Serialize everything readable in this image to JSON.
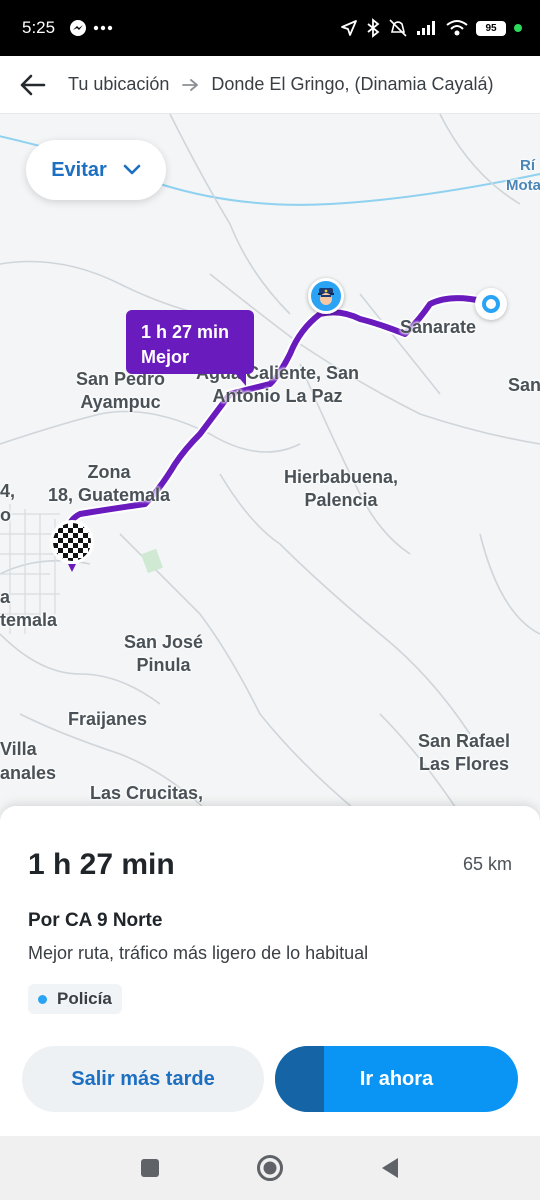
{
  "status_bar": {
    "time": "5:25",
    "battery": "95"
  },
  "header": {
    "from": "Tu ubicación",
    "to": "Donde El Gringo, (Dinamia Cayalá)"
  },
  "map": {
    "avoid_button": "Evitar",
    "route_bubble": {
      "duration": "1 h 27 min",
      "tag": "Mejor"
    },
    "labels": {
      "sanarate": "Sanarate",
      "san_pedro": "San Pedro\nAyampuc",
      "agua_caliente": "Agua Caliente, San\nAntonio La Paz",
      "zona18": "Zona\n18, Guatemala",
      "hierbabuena": "Hierbabuena,\nPalencia",
      "san_jose": "San José\nPinula",
      "fraijanes": "Fraijanes",
      "san_rafael": "San Rafael\nLas Flores",
      "las_crucitas": "Las Crucitas,",
      "edge_4": "4,",
      "edge_o": "o",
      "edge_a": "a",
      "edge_temala": "temala",
      "edge_villa": "Villa",
      "edge_anales": "anales",
      "edge_san": "San",
      "edge_rio": "Rí",
      "edge_mota": "Mota"
    },
    "colors": {
      "route": "#6a1bbd",
      "water": "#8fd1f0",
      "roads": "#c8ced3"
    }
  },
  "sheet": {
    "duration": "1 h 27 min",
    "distance": "65 km",
    "via": "Por CA 9 Norte",
    "description": "Mejor ruta, tráfico más ligero de lo habitual",
    "chip": "Policía",
    "later_button": "Salir más tarde",
    "go_button": "Ir ahora",
    "go_progress": 0.2
  },
  "icons": {
    "back": "arrow-left-icon",
    "route_arrow": "arrow-right-icon",
    "police": "police-officer-icon",
    "origin": "origin-marker-icon",
    "destination": "checkered-flag-icon"
  }
}
